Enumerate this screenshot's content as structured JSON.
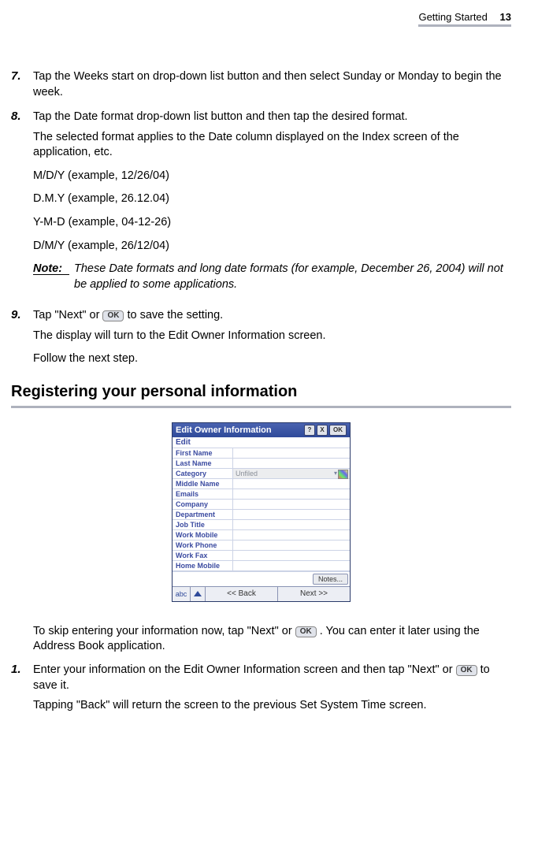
{
  "header": {
    "section": "Getting Started",
    "page": "13"
  },
  "step7": {
    "num": "7.",
    "text": "Tap the Weeks start on drop-down list button and then select Sunday or Monday to begin the week."
  },
  "step8": {
    "num": "8.",
    "text1": "Tap the Date format drop-down list button and then tap the desired format.",
    "text2": "The selected format applies to the Date column displayed on the Index screen of the application, etc.",
    "formats": {
      "a": "M/D/Y (example, 12/26/04)",
      "b": "D.M.Y (example, 26.12.04)",
      "c": "Y-M-D (example, 04-12-26)",
      "d": "D/M/Y (example, 26/12/04)"
    },
    "note_label": "Note:",
    "note_text": "These Date formats and long date formats (for example, December 26, 2004) will not be applied to some applications."
  },
  "step9": {
    "num": "9.",
    "pre": "Tap \"Next\" or ",
    "ok": "OK",
    "post": " to save the setting.",
    "line2": "The display will turn to the Edit Owner Information screen.",
    "line3": "Follow the next step."
  },
  "heading": "Registering your personal information",
  "owner_screen": {
    "title": "Edit Owner Information",
    "help_icon": "?",
    "close_icon": "X",
    "ok_icon": "OK",
    "edit": "Edit",
    "category_value": "Unfiled",
    "fields": {
      "first_name": "First Name",
      "last_name": "Last Name",
      "category": "Category",
      "middle_name": "Middle Name",
      "emails": "Emails",
      "company": "Company",
      "department": "Department",
      "job_title": "Job Title",
      "work_mobile": "Work Mobile",
      "work_phone": "Work Phone",
      "work_fax": "Work Fax",
      "home_mobile": "Home Mobile"
    },
    "notes_btn": "Notes...",
    "footer_abc": "abc",
    "back_btn": "<< Back",
    "next_btn": "Next >>"
  },
  "skip": {
    "pre": "To skip entering your information now, tap \"Next\" or ",
    "ok": "OK",
    "post": ". You can enter it later using the Address Book application."
  },
  "step1": {
    "num": "1.",
    "pre": "Enter your information on the Edit Owner Information screen and then tap \"Next\" or ",
    "ok": "OK",
    "post": " to save it.",
    "line2": "Tapping \"Back\" will return the screen to the previous Set System Time screen."
  }
}
